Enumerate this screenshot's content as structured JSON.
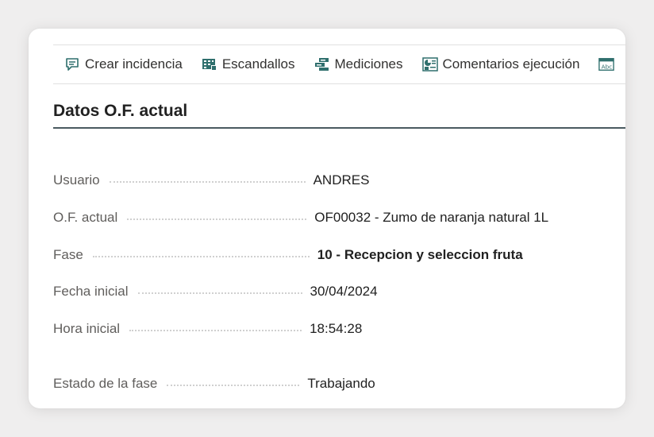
{
  "toolbar": {
    "items": [
      {
        "label": "Crear incidencia",
        "icon": "comment-icon"
      },
      {
        "label": "Escandallos",
        "icon": "film-grid-icon"
      },
      {
        "label": "Mediciones",
        "icon": "measure-icon"
      },
      {
        "label": "Comentarios ejecución",
        "icon": "chart-comment-icon"
      },
      {
        "label": "",
        "icon": "abc-text-icon"
      }
    ]
  },
  "section": {
    "title": "Datos O.F. actual"
  },
  "fields": {
    "usuario": {
      "label": "Usuario",
      "value": "ANDRES"
    },
    "of_actual": {
      "label": "O.F. actual",
      "value": "OF00032 - Zumo de naranja natural 1L"
    },
    "fase": {
      "label": "Fase",
      "value": "10 - Recepcion y seleccion fruta"
    },
    "fecha_inicial": {
      "label": "Fecha inicial",
      "value": "30/04/2024"
    },
    "hora_inicial": {
      "label": "Hora inicial",
      "value": "18:54:28"
    },
    "estado_fase": {
      "label": "Estado de la fase",
      "value": "Trabajando"
    }
  },
  "colors": {
    "accent_icon": "#2f6f6d",
    "section_rule": "#4a5a60"
  }
}
